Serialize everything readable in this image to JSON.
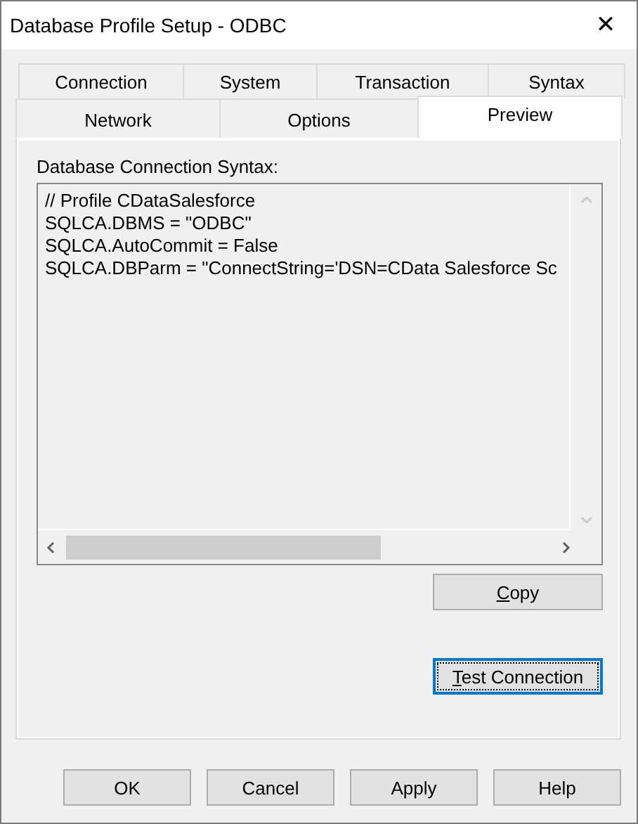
{
  "window": {
    "title": "Database Profile Setup - ODBC",
    "close_glyph": "✕"
  },
  "tab_rows": [
    [
      {
        "label": "Connection",
        "selected": false
      },
      {
        "label": "System",
        "selected": false
      },
      {
        "label": "Transaction",
        "selected": false
      },
      {
        "label": "Syntax",
        "selected": false
      }
    ],
    [
      {
        "label": "Network",
        "selected": false
      },
      {
        "label": "Options",
        "selected": false
      },
      {
        "label": "Preview",
        "selected": true
      }
    ]
  ],
  "syntax_label": "Database Connection Syntax:",
  "syntax_lines": [
    "// Profile CDataSalesforce",
    "SQLCA.DBMS = \"ODBC\"",
    "SQLCA.AutoCommit = False",
    "SQLCA.DBParm = \"ConnectString='DSN=CData Salesforce Sc"
  ],
  "panel_buttons": [
    {
      "label": "Copy",
      "underline_first": true,
      "focused": false
    },
    {
      "label": "Test Connection",
      "underline_first": true,
      "focused": true
    }
  ],
  "buttons": [
    "OK",
    "Cancel",
    "Apply",
    "Help"
  ]
}
